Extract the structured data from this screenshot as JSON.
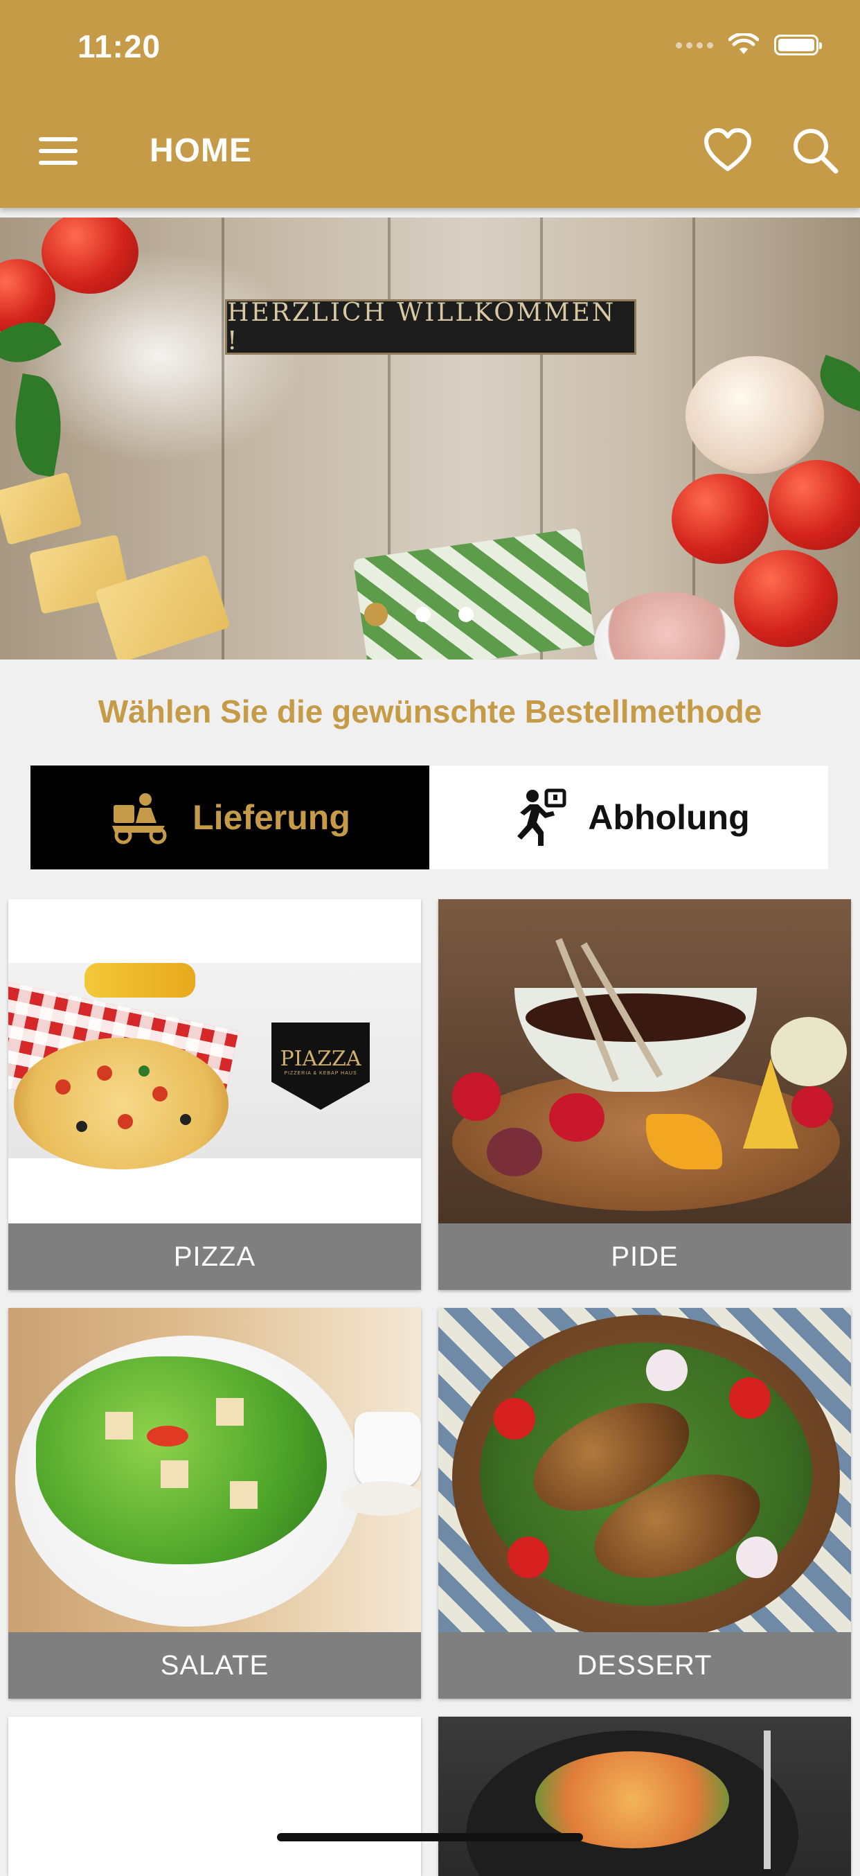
{
  "status_bar": {
    "time": "11:20"
  },
  "header": {
    "title": "HOME"
  },
  "banner": {
    "sign_text": "HERZLICH WILLKOMMEN !",
    "slide_count": 3,
    "active_slide": 1
  },
  "order": {
    "prompt": "Wählen Sie die gewünschte Bestellmethode",
    "delivery_label": "Lieferung",
    "pickup_label": "Abholung",
    "selected": "Lieferung"
  },
  "categories": [
    {
      "label": "PIZZA",
      "logo_text": "PIAZZA",
      "logo_sub": "PIZZERIA & KEBAP HAUS"
    },
    {
      "label": "PIDE"
    },
    {
      "label": "SALATE"
    },
    {
      "label": "DESSERT"
    }
  ],
  "colors": {
    "brand": "#c59b48",
    "dark": "#000000",
    "label_bg": "#7f7f7f"
  }
}
